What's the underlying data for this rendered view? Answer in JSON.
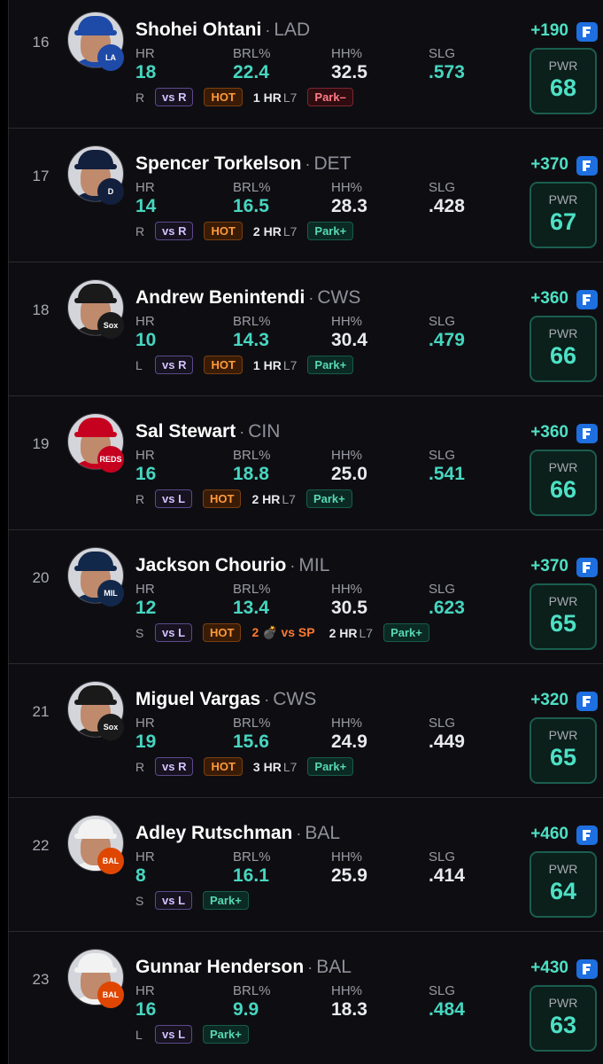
{
  "stat_labels": {
    "hr": "HR",
    "brl": "BRL%",
    "hh": "HH%",
    "slg": "SLG",
    "pwr": "PWR"
  },
  "colors": {
    "accent": "#4de0c4",
    "hot": "#ff9a3c",
    "park_plus": "#58d8b5",
    "park_minus": "#ff7b86"
  },
  "players": [
    {
      "rank": "16",
      "name": "Shohei Ohtani",
      "team": "LAD",
      "hr": "18",
      "brl": "22.4",
      "hh": "32.5",
      "slg": ".573",
      "slg_color": "teal",
      "hand": "R",
      "vs": "vs R",
      "hot": "HOT",
      "l7": "1 HR",
      "l7_suffix": "L7",
      "park": "Park–",
      "park_type": "minus",
      "odds": "+190",
      "pwr": "68",
      "cap": "#1e4aa8",
      "logo": "#1e4aa8",
      "logo_text": "LA"
    },
    {
      "rank": "17",
      "name": "Spencer Torkelson",
      "team": "DET",
      "hr": "14",
      "brl": "16.5",
      "hh": "28.3",
      "slg": ".428",
      "slg_color": "white",
      "hand": "R",
      "vs": "vs R",
      "hot": "HOT",
      "l7": "2 HR",
      "l7_suffix": "L7",
      "park": "Park+",
      "park_type": "plus",
      "odds": "+370",
      "pwr": "67",
      "cap": "#12203d",
      "logo": "#12203d",
      "logo_text": "D"
    },
    {
      "rank": "18",
      "name": "Andrew Benintendi",
      "team": "CWS",
      "hr": "10",
      "brl": "14.3",
      "hh": "30.4",
      "slg": ".479",
      "slg_color": "teal",
      "hand": "L",
      "vs": "vs R",
      "hot": "HOT",
      "l7": "1 HR",
      "l7_suffix": "L7",
      "park": "Park+",
      "park_type": "plus",
      "odds": "+360",
      "pwr": "66",
      "cap": "#1a1a1a",
      "logo": "#1a1a1a",
      "logo_text": "Sox"
    },
    {
      "rank": "19",
      "name": "Sal Stewart",
      "team": "CIN",
      "hr": "16",
      "brl": "18.8",
      "hh": "25.0",
      "slg": ".541",
      "slg_color": "teal",
      "hand": "R",
      "vs": "vs L",
      "hot": "HOT",
      "l7": "2 HR",
      "l7_suffix": "L7",
      "park": "Park+",
      "park_type": "plus",
      "odds": "+360",
      "pwr": "66",
      "cap": "#c6011f",
      "logo": "#c6011f",
      "logo_text": "REDS"
    },
    {
      "rank": "20",
      "name": "Jackson Chourio",
      "team": "MIL",
      "hr": "12",
      "brl": "13.4",
      "hh": "30.5",
      "slg": ".623",
      "slg_color": "teal",
      "hand": "S",
      "vs": "vs L",
      "hot": "HOT",
      "vs_sp": "2 💣 vs SP",
      "l7": "2 HR",
      "l7_suffix": "L7",
      "park": "Park+",
      "park_type": "plus",
      "odds": "+370",
      "pwr": "65",
      "cap": "#12284b",
      "logo": "#12284b",
      "logo_text": "MIL"
    },
    {
      "rank": "21",
      "name": "Miguel Vargas",
      "team": "CWS",
      "hr": "19",
      "brl": "15.6",
      "hh": "24.9",
      "slg": ".449",
      "slg_color": "white",
      "hand": "R",
      "vs": "vs R",
      "hot": "HOT",
      "l7": "3 HR",
      "l7_suffix": "L7",
      "park": "Park+",
      "park_type": "plus",
      "odds": "+320",
      "pwr": "65",
      "cap": "#1a1a1a",
      "logo": "#1a1a1a",
      "logo_text": "Sox"
    },
    {
      "rank": "22",
      "name": "Adley Rutschman",
      "team": "BAL",
      "hr": "8",
      "brl": "16.1",
      "hh": "25.9",
      "slg": ".414",
      "slg_color": "white",
      "hand": "S",
      "vs": "vs L",
      "park": "Park+",
      "park_type": "plus",
      "odds": "+460",
      "pwr": "64",
      "cap": "#f2f2f2",
      "logo": "#df4601",
      "logo_text": "BAL"
    },
    {
      "rank": "23",
      "name": "Gunnar Henderson",
      "team": "BAL",
      "hr": "16",
      "brl": "9.9",
      "hh": "18.3",
      "slg": ".484",
      "slg_color": "teal",
      "hand": "L",
      "vs": "vs L",
      "park": "Park+",
      "park_type": "plus",
      "odds": "+430",
      "pwr": "63",
      "cap": "#f2f2f2",
      "logo": "#df4601",
      "logo_text": "BAL"
    }
  ]
}
